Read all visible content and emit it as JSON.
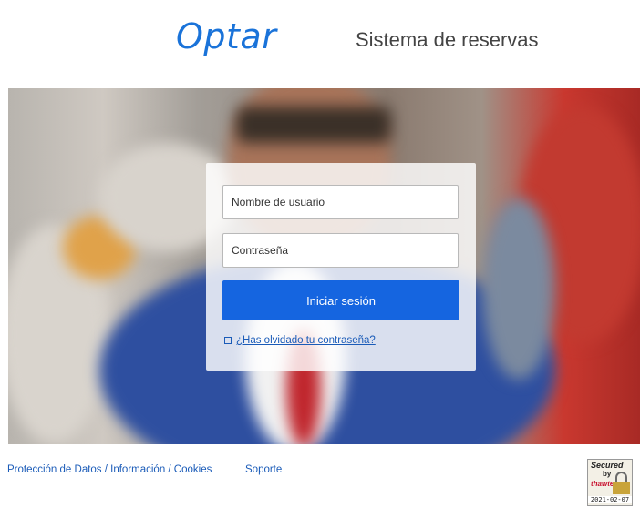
{
  "header": {
    "logo_text": "Optar",
    "app_title": "Sistema de reservas"
  },
  "login": {
    "username_placeholder": "Nombre de usuario",
    "username_value": "",
    "password_placeholder": "Contraseña",
    "password_value": "",
    "submit_label": "Iniciar sesión",
    "forgot_label": "¿Has olvidado tu contraseña?"
  },
  "footer": {
    "links": [
      {
        "label": "Protección de Datos / Información / Cookies"
      },
      {
        "label": "Soporte"
      }
    ],
    "seal": {
      "line1": "Secured",
      "line2": "by",
      "line3": "thawte",
      "date": "2021-02-07"
    }
  },
  "colors": {
    "brand_blue": "#1a73d9",
    "button_blue": "#1565e0",
    "link_blue": "#1a5bb8"
  },
  "icons": {
    "forgot_icon": "arrow-box-icon",
    "seal_icon": "lock-icon"
  }
}
